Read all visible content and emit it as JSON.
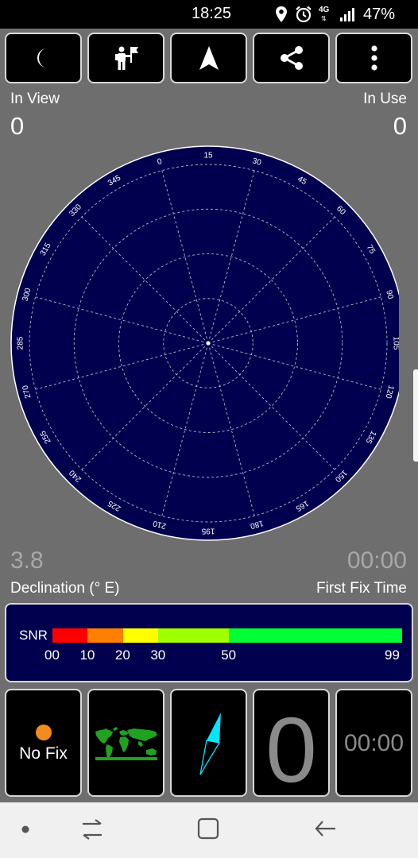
{
  "status_bar": {
    "time": "18:25",
    "network": "4G",
    "battery": "47%",
    "icons": [
      "location-icon",
      "alarm-icon",
      "network-4g-icon",
      "signal-icon"
    ]
  },
  "toolbar": {
    "buttons": [
      {
        "name": "night-mode-button",
        "icon": "moon-icon"
      },
      {
        "name": "map-person-button",
        "icon": "person-flag-icon"
      },
      {
        "name": "navigate-button",
        "icon": "navigation-arrow-icon"
      },
      {
        "name": "share-button",
        "icon": "share-icon"
      },
      {
        "name": "more-options-button",
        "icon": "more-vertical-icon"
      }
    ]
  },
  "counts": {
    "in_view_label": "In View",
    "in_view_value": "0",
    "in_use_label": "In Use",
    "in_use_value": "0"
  },
  "radar": {
    "bearings": [
      "0",
      "15",
      "30",
      "45",
      "60",
      "75",
      "90",
      "105",
      "120",
      "135",
      "150",
      "165",
      "180",
      "195",
      "210",
      "225",
      "240",
      "255",
      "270",
      "285",
      "300",
      "315",
      "330",
      "345"
    ],
    "colors": {
      "background": "#00004e",
      "grid": "#b9b9c8",
      "labels": "#ffffff"
    }
  },
  "declination": {
    "value": "3.8",
    "label": "Declination (° E)"
  },
  "first_fix": {
    "value": "00:00",
    "label": "First Fix Time"
  },
  "snr": {
    "label": "SNR",
    "scale_max": 99,
    "segments": [
      {
        "from": 0,
        "to": 10,
        "color": "#ff0000"
      },
      {
        "from": 10,
        "to": 20,
        "color": "#ff8000"
      },
      {
        "from": 20,
        "to": 30,
        "color": "#ffff00"
      },
      {
        "from": 30,
        "to": 50,
        "color": "#a0ff00"
      },
      {
        "from": 50,
        "to": 99,
        "color": "#00ff33"
      }
    ],
    "ticks": [
      "00",
      "10",
      "20",
      "30",
      "50",
      "99"
    ]
  },
  "tiles": {
    "fix_status": "No Fix",
    "fix_dot_color": "#f28c1f",
    "world_map_icon": "world-map-icon",
    "compass_icon": "compass-needle-icon",
    "satellite_count": "0",
    "fix_time": "00:00"
  },
  "nav_bar": {
    "buttons": [
      {
        "name": "nav-dot-button",
        "icon": "dot-icon"
      },
      {
        "name": "recents-button",
        "icon": "recents-icon"
      },
      {
        "name": "home-button",
        "icon": "home-icon"
      },
      {
        "name": "back-button",
        "icon": "back-arrow-icon"
      }
    ]
  }
}
